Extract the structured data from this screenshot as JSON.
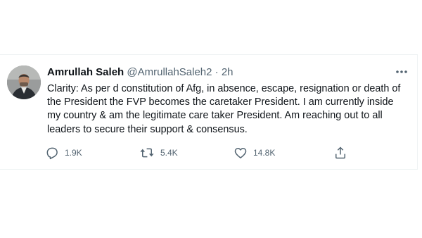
{
  "tweet": {
    "display_name": "Amrullah Saleh",
    "handle": "@AmrullahSaleh2",
    "separator": "·",
    "time": "2h",
    "text": "Clarity: As per d constitution of Afg, in absence, escape, resignation or death of the President the FVP becomes the caretaker President. I am currently inside my country & am the legitimate care taker President. Am reaching out to all leaders to secure their support & consensus.",
    "actions": {
      "reply_count": "1.9K",
      "retweet_count": "5.4K",
      "like_count": "14.8K"
    }
  },
  "icons": {
    "avatar": "profile-photo",
    "more": "more-horizontal-icon",
    "reply": "reply-icon",
    "retweet": "retweet-icon",
    "like": "heart-icon",
    "share": "share-icon"
  },
  "colors": {
    "text": "#0f1419",
    "secondary": "#536471",
    "border": "#eff3f4"
  }
}
